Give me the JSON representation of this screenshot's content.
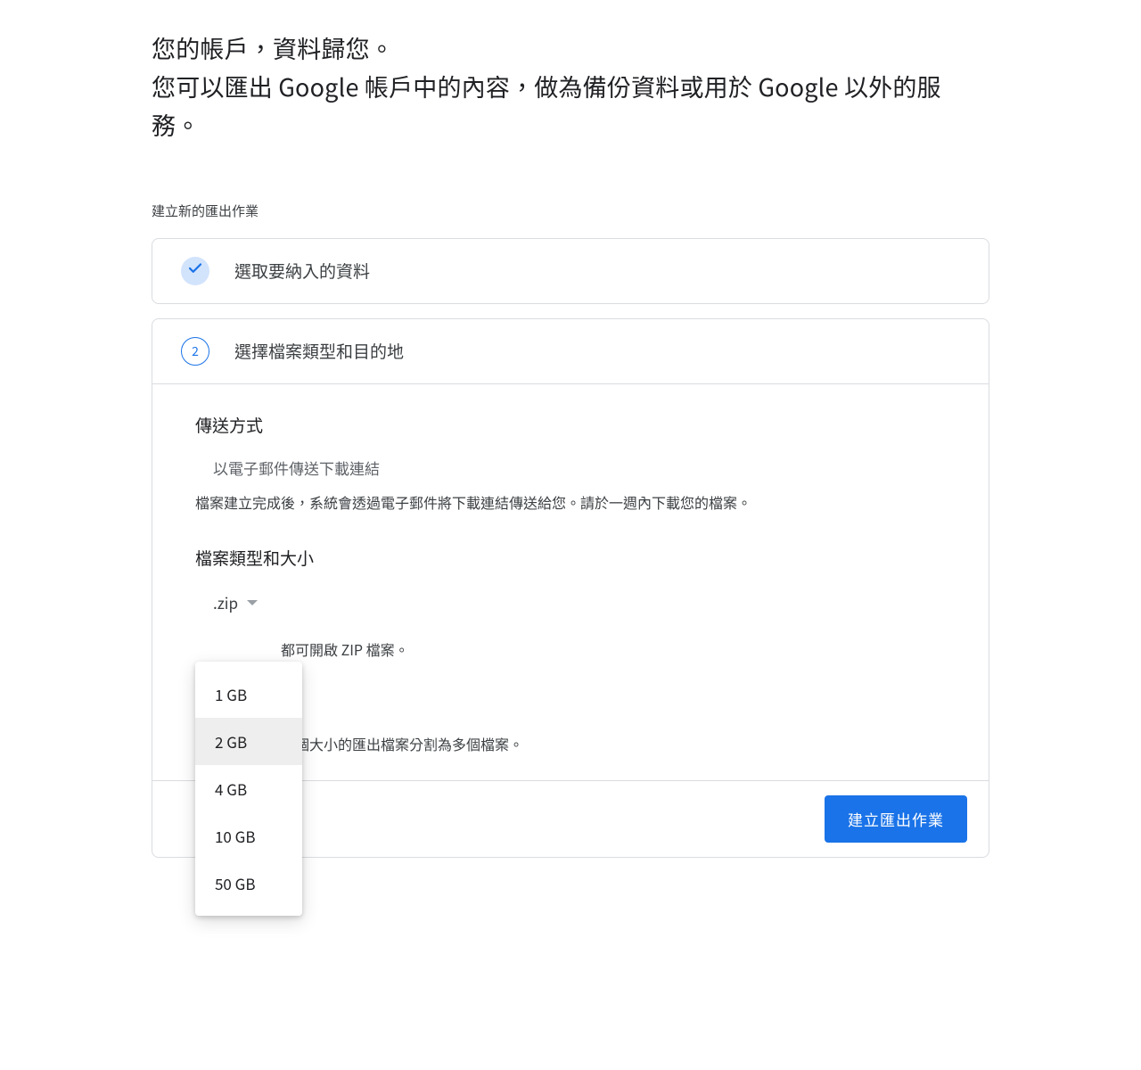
{
  "intro": {
    "line1": "您的帳戶，資料歸您。",
    "line2": "您可以匯出 Google 帳戶中的內容，做為備份資料或用於 Google 以外的服務。"
  },
  "section_label": "建立新的匯出作業",
  "step1": {
    "status": "done",
    "title": "選取要納入的資料"
  },
  "step2": {
    "number": "2",
    "title": "選擇檔案類型和目的地",
    "delivery": {
      "heading": "傳送方式",
      "selected": "以電子郵件傳送下載連結",
      "hint": "檔案建立完成後，系統會透過電子郵件將下載連結傳送給您。請於一週內下載您的檔案。"
    },
    "filetype": {
      "heading": "檔案類型和大小",
      "type_value": ".zip",
      "type_hint_tail": "都可開啟 ZIP 檔案。",
      "size_hint_tail": "這個大小的匯出檔案分割為多個檔案。",
      "size_options": [
        "1 GB",
        "2 GB",
        "4 GB",
        "10 GB",
        "50 GB"
      ],
      "size_selected_index": 1
    },
    "submit_label": "建立匯出作業"
  },
  "icons": {
    "check": "check-icon",
    "dropdown": "chevron-down-icon"
  }
}
